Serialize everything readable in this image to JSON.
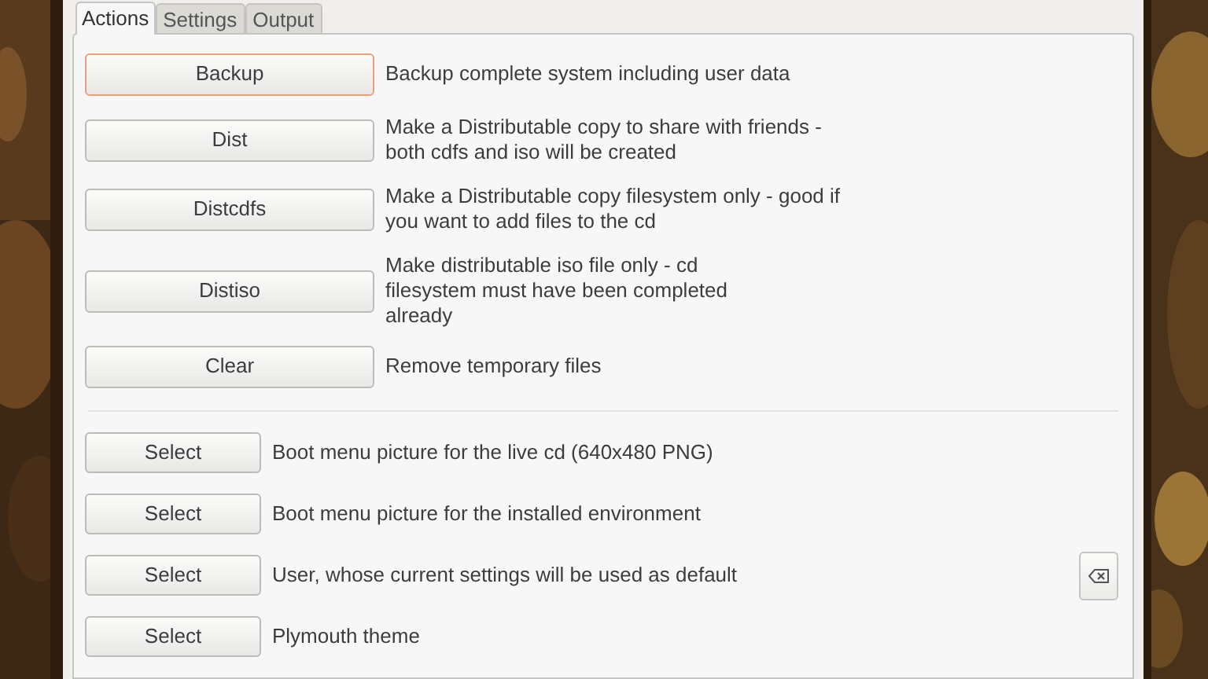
{
  "tabs": [
    {
      "label": "Actions",
      "selected": true
    },
    {
      "label": "Settings",
      "selected": false
    },
    {
      "label": "Output",
      "selected": false
    }
  ],
  "actions": [
    {
      "label": "Backup",
      "description": "Backup complete system including user data",
      "focused": true
    },
    {
      "label": "Dist",
      "description": "Make a Distributable copy to share with friends -\nboth cdfs and iso will be created",
      "focused": false
    },
    {
      "label": "Distcdfs",
      "description": "Make a Distributable copy filesystem only - good if\nyou want to add files to the cd",
      "focused": false
    },
    {
      "label": "Distiso",
      "description": "Make distributable iso file only - cd\nfilesystem must have been completed\nalready",
      "focused": false
    },
    {
      "label": "Clear",
      "description": "Remove temporary files",
      "focused": false
    }
  ],
  "selects": [
    {
      "label": "Select",
      "description": "Boot menu picture for the live cd (640x480 PNG)",
      "clear_button": false
    },
    {
      "label": "Select",
      "description": "Boot menu picture for the installed environment",
      "clear_button": false
    },
    {
      "label": "Select",
      "description": "User, whose current settings will be used as default",
      "clear_button": true
    },
    {
      "label": "Select",
      "description": "Plymouth theme",
      "clear_button": false
    }
  ]
}
